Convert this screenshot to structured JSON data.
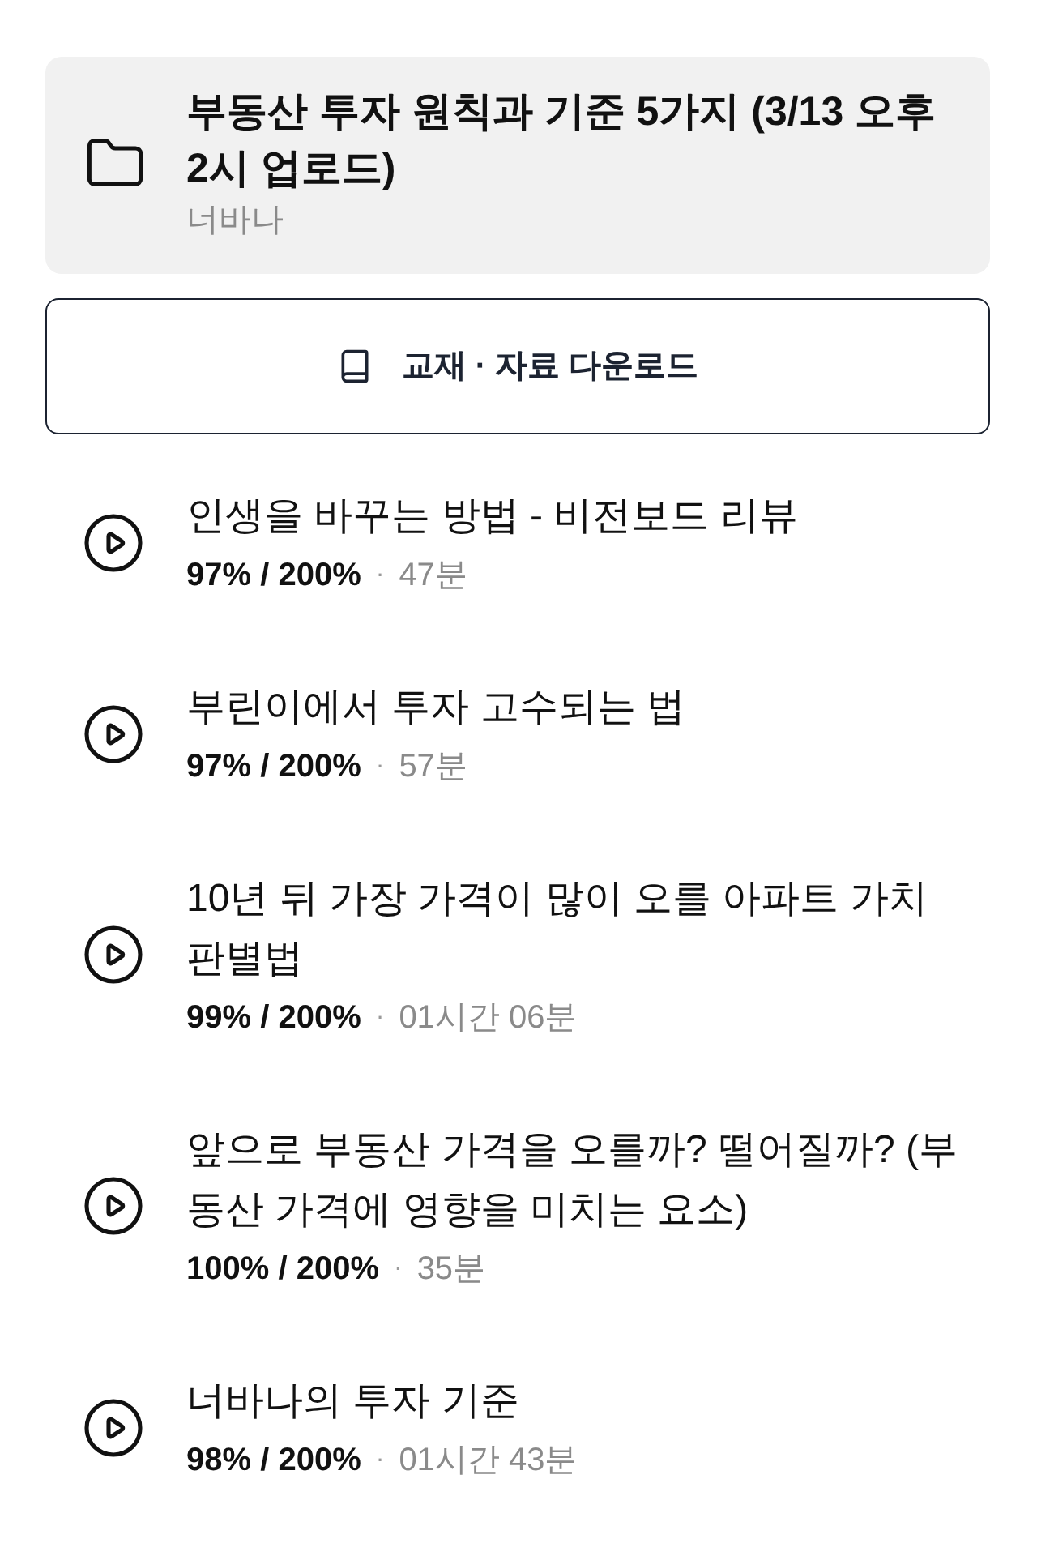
{
  "header": {
    "title": "부동산 투자 원칙과 기준 5가지 (3/13 오후 2시 업로드)",
    "author": "너바나"
  },
  "download_button": {
    "label": "교재 · 자료 다운로드"
  },
  "lessons": [
    {
      "title": "인생을 바꾸는 방법 - 비전보드 리뷰",
      "progress": "97% / 200%",
      "separator": "·",
      "duration": "47분"
    },
    {
      "title": "부린이에서 투자 고수되는 법",
      "progress": "97% / 200%",
      "separator": "·",
      "duration": "57분"
    },
    {
      "title": "10년 뒤 가장 가격이 많이 오를 아파트 가치 판별법",
      "progress": "99% / 200%",
      "separator": "·",
      "duration": "01시간 06분"
    },
    {
      "title": "앞으로 부동산 가격을 오를까? 떨어질까? (부동산 가격에 영향을 미치는 요소)",
      "progress": "100% / 200%",
      "separator": "·",
      "duration": "35분"
    },
    {
      "title": "너바나의 투자 기준",
      "progress": "98% / 200%",
      "separator": "·",
      "duration": "01시간 43분"
    }
  ]
}
